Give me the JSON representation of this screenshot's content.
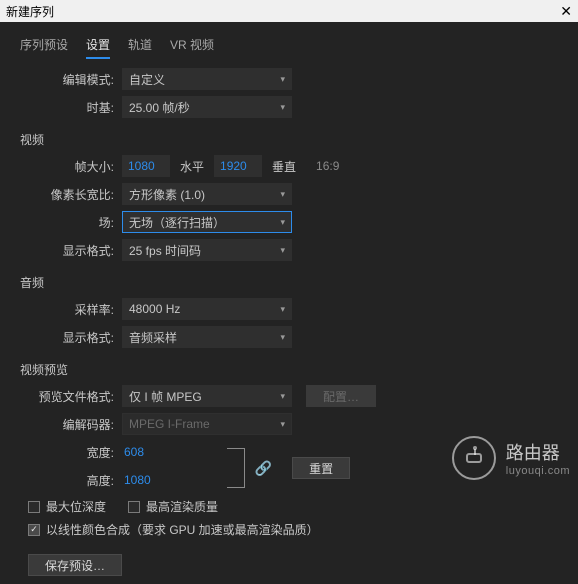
{
  "title": "新建序列",
  "tabs": {
    "preset": "序列预设",
    "settings": "设置",
    "tracks": "轨道",
    "vr": "VR 视频"
  },
  "labels": {
    "edit_mode": "编辑模式:",
    "timebase": "时基:",
    "video_section": "视频",
    "frame_size": "帧大小:",
    "horizontal": "水平",
    "vertical": "垂直",
    "aspect_ratio": "16:9",
    "pixel_aspect": "像素长宽比:",
    "fields": "场:",
    "display_format": "显示格式:",
    "audio_section": "音频",
    "sample_rate": "采样率:",
    "audio_display_format": "显示格式:",
    "preview_section": "视频预览",
    "preview_format": "预览文件格式:",
    "codec": "编解码器:",
    "width": "宽度:",
    "height": "高度:",
    "max_bit_depth": "最大位深度",
    "max_render_quality": "最高渲染质量",
    "linear_color": "以线性颜色合成（要求 GPU 加速或最高渲染品质）",
    "config_btn": "配置…",
    "reset_btn": "重置",
    "save_preset_btn": "保存预设…"
  },
  "values": {
    "edit_mode": "自定义",
    "timebase": "25.00 帧/秒",
    "frame_w": "1080",
    "frame_h": "1920",
    "pixel_aspect": "方形像素 (1.0)",
    "fields": "无场（逐行扫描）",
    "video_display_format": "25 fps 时间码",
    "sample_rate": "48000 Hz",
    "audio_display_format": "音频采样",
    "preview_format": "仅 I 帧 MPEG",
    "codec": "MPEG I-Frame",
    "preview_w": "608",
    "preview_h": "1080"
  },
  "watermark": {
    "big": "路由器",
    "small": "luyouqi.com"
  }
}
